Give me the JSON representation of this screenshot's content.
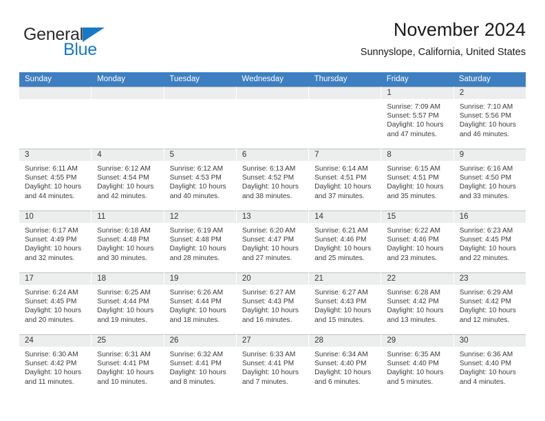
{
  "brand": {
    "name_part1": "General",
    "name_part2": "Blue",
    "flag_icon": "triangle-flag-icon",
    "accent_color": "#1878c8"
  },
  "header": {
    "title": "November 2024",
    "location": "Sunnyslope, California, United States"
  },
  "theme": {
    "header_row_bg": "#3d7fc1",
    "day_number_band_bg": "#eceded",
    "grid_line": "#bfbfbf",
    "text": "#3a3a3a"
  },
  "calendar": {
    "weekday_headers": [
      "Sunday",
      "Monday",
      "Tuesday",
      "Wednesday",
      "Thursday",
      "Friday",
      "Saturday"
    ],
    "weeks": [
      [
        {
          "day": "",
          "sunrise": "",
          "sunset": "",
          "daylight_line1": "",
          "daylight_line2": "",
          "empty": true
        },
        {
          "day": "",
          "sunrise": "",
          "sunset": "",
          "daylight_line1": "",
          "daylight_line2": "",
          "empty": true
        },
        {
          "day": "",
          "sunrise": "",
          "sunset": "",
          "daylight_line1": "",
          "daylight_line2": "",
          "empty": true
        },
        {
          "day": "",
          "sunrise": "",
          "sunset": "",
          "daylight_line1": "",
          "daylight_line2": "",
          "empty": true
        },
        {
          "day": "",
          "sunrise": "",
          "sunset": "",
          "daylight_line1": "",
          "daylight_line2": "",
          "empty": true
        },
        {
          "day": "1",
          "sunrise": "Sunrise: 7:09 AM",
          "sunset": "Sunset: 5:57 PM",
          "daylight_line1": "Daylight: 10 hours",
          "daylight_line2": "and 47 minutes.",
          "empty": false
        },
        {
          "day": "2",
          "sunrise": "Sunrise: 7:10 AM",
          "sunset": "Sunset: 5:56 PM",
          "daylight_line1": "Daylight: 10 hours",
          "daylight_line2": "and 46 minutes.",
          "empty": false
        }
      ],
      [
        {
          "day": "3",
          "sunrise": "Sunrise: 6:11 AM",
          "sunset": "Sunset: 4:55 PM",
          "daylight_line1": "Daylight: 10 hours",
          "daylight_line2": "and 44 minutes.",
          "empty": false
        },
        {
          "day": "4",
          "sunrise": "Sunrise: 6:12 AM",
          "sunset": "Sunset: 4:54 PM",
          "daylight_line1": "Daylight: 10 hours",
          "daylight_line2": "and 42 minutes.",
          "empty": false
        },
        {
          "day": "5",
          "sunrise": "Sunrise: 6:12 AM",
          "sunset": "Sunset: 4:53 PM",
          "daylight_line1": "Daylight: 10 hours",
          "daylight_line2": "and 40 minutes.",
          "empty": false
        },
        {
          "day": "6",
          "sunrise": "Sunrise: 6:13 AM",
          "sunset": "Sunset: 4:52 PM",
          "daylight_line1": "Daylight: 10 hours",
          "daylight_line2": "and 38 minutes.",
          "empty": false
        },
        {
          "day": "7",
          "sunrise": "Sunrise: 6:14 AM",
          "sunset": "Sunset: 4:51 PM",
          "daylight_line1": "Daylight: 10 hours",
          "daylight_line2": "and 37 minutes.",
          "empty": false
        },
        {
          "day": "8",
          "sunrise": "Sunrise: 6:15 AM",
          "sunset": "Sunset: 4:51 PM",
          "daylight_line1": "Daylight: 10 hours",
          "daylight_line2": "and 35 minutes.",
          "empty": false
        },
        {
          "day": "9",
          "sunrise": "Sunrise: 6:16 AM",
          "sunset": "Sunset: 4:50 PM",
          "daylight_line1": "Daylight: 10 hours",
          "daylight_line2": "and 33 minutes.",
          "empty": false
        }
      ],
      [
        {
          "day": "10",
          "sunrise": "Sunrise: 6:17 AM",
          "sunset": "Sunset: 4:49 PM",
          "daylight_line1": "Daylight: 10 hours",
          "daylight_line2": "and 32 minutes.",
          "empty": false
        },
        {
          "day": "11",
          "sunrise": "Sunrise: 6:18 AM",
          "sunset": "Sunset: 4:48 PM",
          "daylight_line1": "Daylight: 10 hours",
          "daylight_line2": "and 30 minutes.",
          "empty": false
        },
        {
          "day": "12",
          "sunrise": "Sunrise: 6:19 AM",
          "sunset": "Sunset: 4:48 PM",
          "daylight_line1": "Daylight: 10 hours",
          "daylight_line2": "and 28 minutes.",
          "empty": false
        },
        {
          "day": "13",
          "sunrise": "Sunrise: 6:20 AM",
          "sunset": "Sunset: 4:47 PM",
          "daylight_line1": "Daylight: 10 hours",
          "daylight_line2": "and 27 minutes.",
          "empty": false
        },
        {
          "day": "14",
          "sunrise": "Sunrise: 6:21 AM",
          "sunset": "Sunset: 4:46 PM",
          "daylight_line1": "Daylight: 10 hours",
          "daylight_line2": "and 25 minutes.",
          "empty": false
        },
        {
          "day": "15",
          "sunrise": "Sunrise: 6:22 AM",
          "sunset": "Sunset: 4:46 PM",
          "daylight_line1": "Daylight: 10 hours",
          "daylight_line2": "and 23 minutes.",
          "empty": false
        },
        {
          "day": "16",
          "sunrise": "Sunrise: 6:23 AM",
          "sunset": "Sunset: 4:45 PM",
          "daylight_line1": "Daylight: 10 hours",
          "daylight_line2": "and 22 minutes.",
          "empty": false
        }
      ],
      [
        {
          "day": "17",
          "sunrise": "Sunrise: 6:24 AM",
          "sunset": "Sunset: 4:45 PM",
          "daylight_line1": "Daylight: 10 hours",
          "daylight_line2": "and 20 minutes.",
          "empty": false
        },
        {
          "day": "18",
          "sunrise": "Sunrise: 6:25 AM",
          "sunset": "Sunset: 4:44 PM",
          "daylight_line1": "Daylight: 10 hours",
          "daylight_line2": "and 19 minutes.",
          "empty": false
        },
        {
          "day": "19",
          "sunrise": "Sunrise: 6:26 AM",
          "sunset": "Sunset: 4:44 PM",
          "daylight_line1": "Daylight: 10 hours",
          "daylight_line2": "and 18 minutes.",
          "empty": false
        },
        {
          "day": "20",
          "sunrise": "Sunrise: 6:27 AM",
          "sunset": "Sunset: 4:43 PM",
          "daylight_line1": "Daylight: 10 hours",
          "daylight_line2": "and 16 minutes.",
          "empty": false
        },
        {
          "day": "21",
          "sunrise": "Sunrise: 6:27 AM",
          "sunset": "Sunset: 4:43 PM",
          "daylight_line1": "Daylight: 10 hours",
          "daylight_line2": "and 15 minutes.",
          "empty": false
        },
        {
          "day": "22",
          "sunrise": "Sunrise: 6:28 AM",
          "sunset": "Sunset: 4:42 PM",
          "daylight_line1": "Daylight: 10 hours",
          "daylight_line2": "and 13 minutes.",
          "empty": false
        },
        {
          "day": "23",
          "sunrise": "Sunrise: 6:29 AM",
          "sunset": "Sunset: 4:42 PM",
          "daylight_line1": "Daylight: 10 hours",
          "daylight_line2": "and 12 minutes.",
          "empty": false
        }
      ],
      [
        {
          "day": "24",
          "sunrise": "Sunrise: 6:30 AM",
          "sunset": "Sunset: 4:42 PM",
          "daylight_line1": "Daylight: 10 hours",
          "daylight_line2": "and 11 minutes.",
          "empty": false
        },
        {
          "day": "25",
          "sunrise": "Sunrise: 6:31 AM",
          "sunset": "Sunset: 4:41 PM",
          "daylight_line1": "Daylight: 10 hours",
          "daylight_line2": "and 10 minutes.",
          "empty": false
        },
        {
          "day": "26",
          "sunrise": "Sunrise: 6:32 AM",
          "sunset": "Sunset: 4:41 PM",
          "daylight_line1": "Daylight: 10 hours",
          "daylight_line2": "and 8 minutes.",
          "empty": false
        },
        {
          "day": "27",
          "sunrise": "Sunrise: 6:33 AM",
          "sunset": "Sunset: 4:41 PM",
          "daylight_line1": "Daylight: 10 hours",
          "daylight_line2": "and 7 minutes.",
          "empty": false
        },
        {
          "day": "28",
          "sunrise": "Sunrise: 6:34 AM",
          "sunset": "Sunset: 4:40 PM",
          "daylight_line1": "Daylight: 10 hours",
          "daylight_line2": "and 6 minutes.",
          "empty": false
        },
        {
          "day": "29",
          "sunrise": "Sunrise: 6:35 AM",
          "sunset": "Sunset: 4:40 PM",
          "daylight_line1": "Daylight: 10 hours",
          "daylight_line2": "and 5 minutes.",
          "empty": false
        },
        {
          "day": "30",
          "sunrise": "Sunrise: 6:36 AM",
          "sunset": "Sunset: 4:40 PM",
          "daylight_line1": "Daylight: 10 hours",
          "daylight_line2": "and 4 minutes.",
          "empty": false
        }
      ]
    ]
  }
}
